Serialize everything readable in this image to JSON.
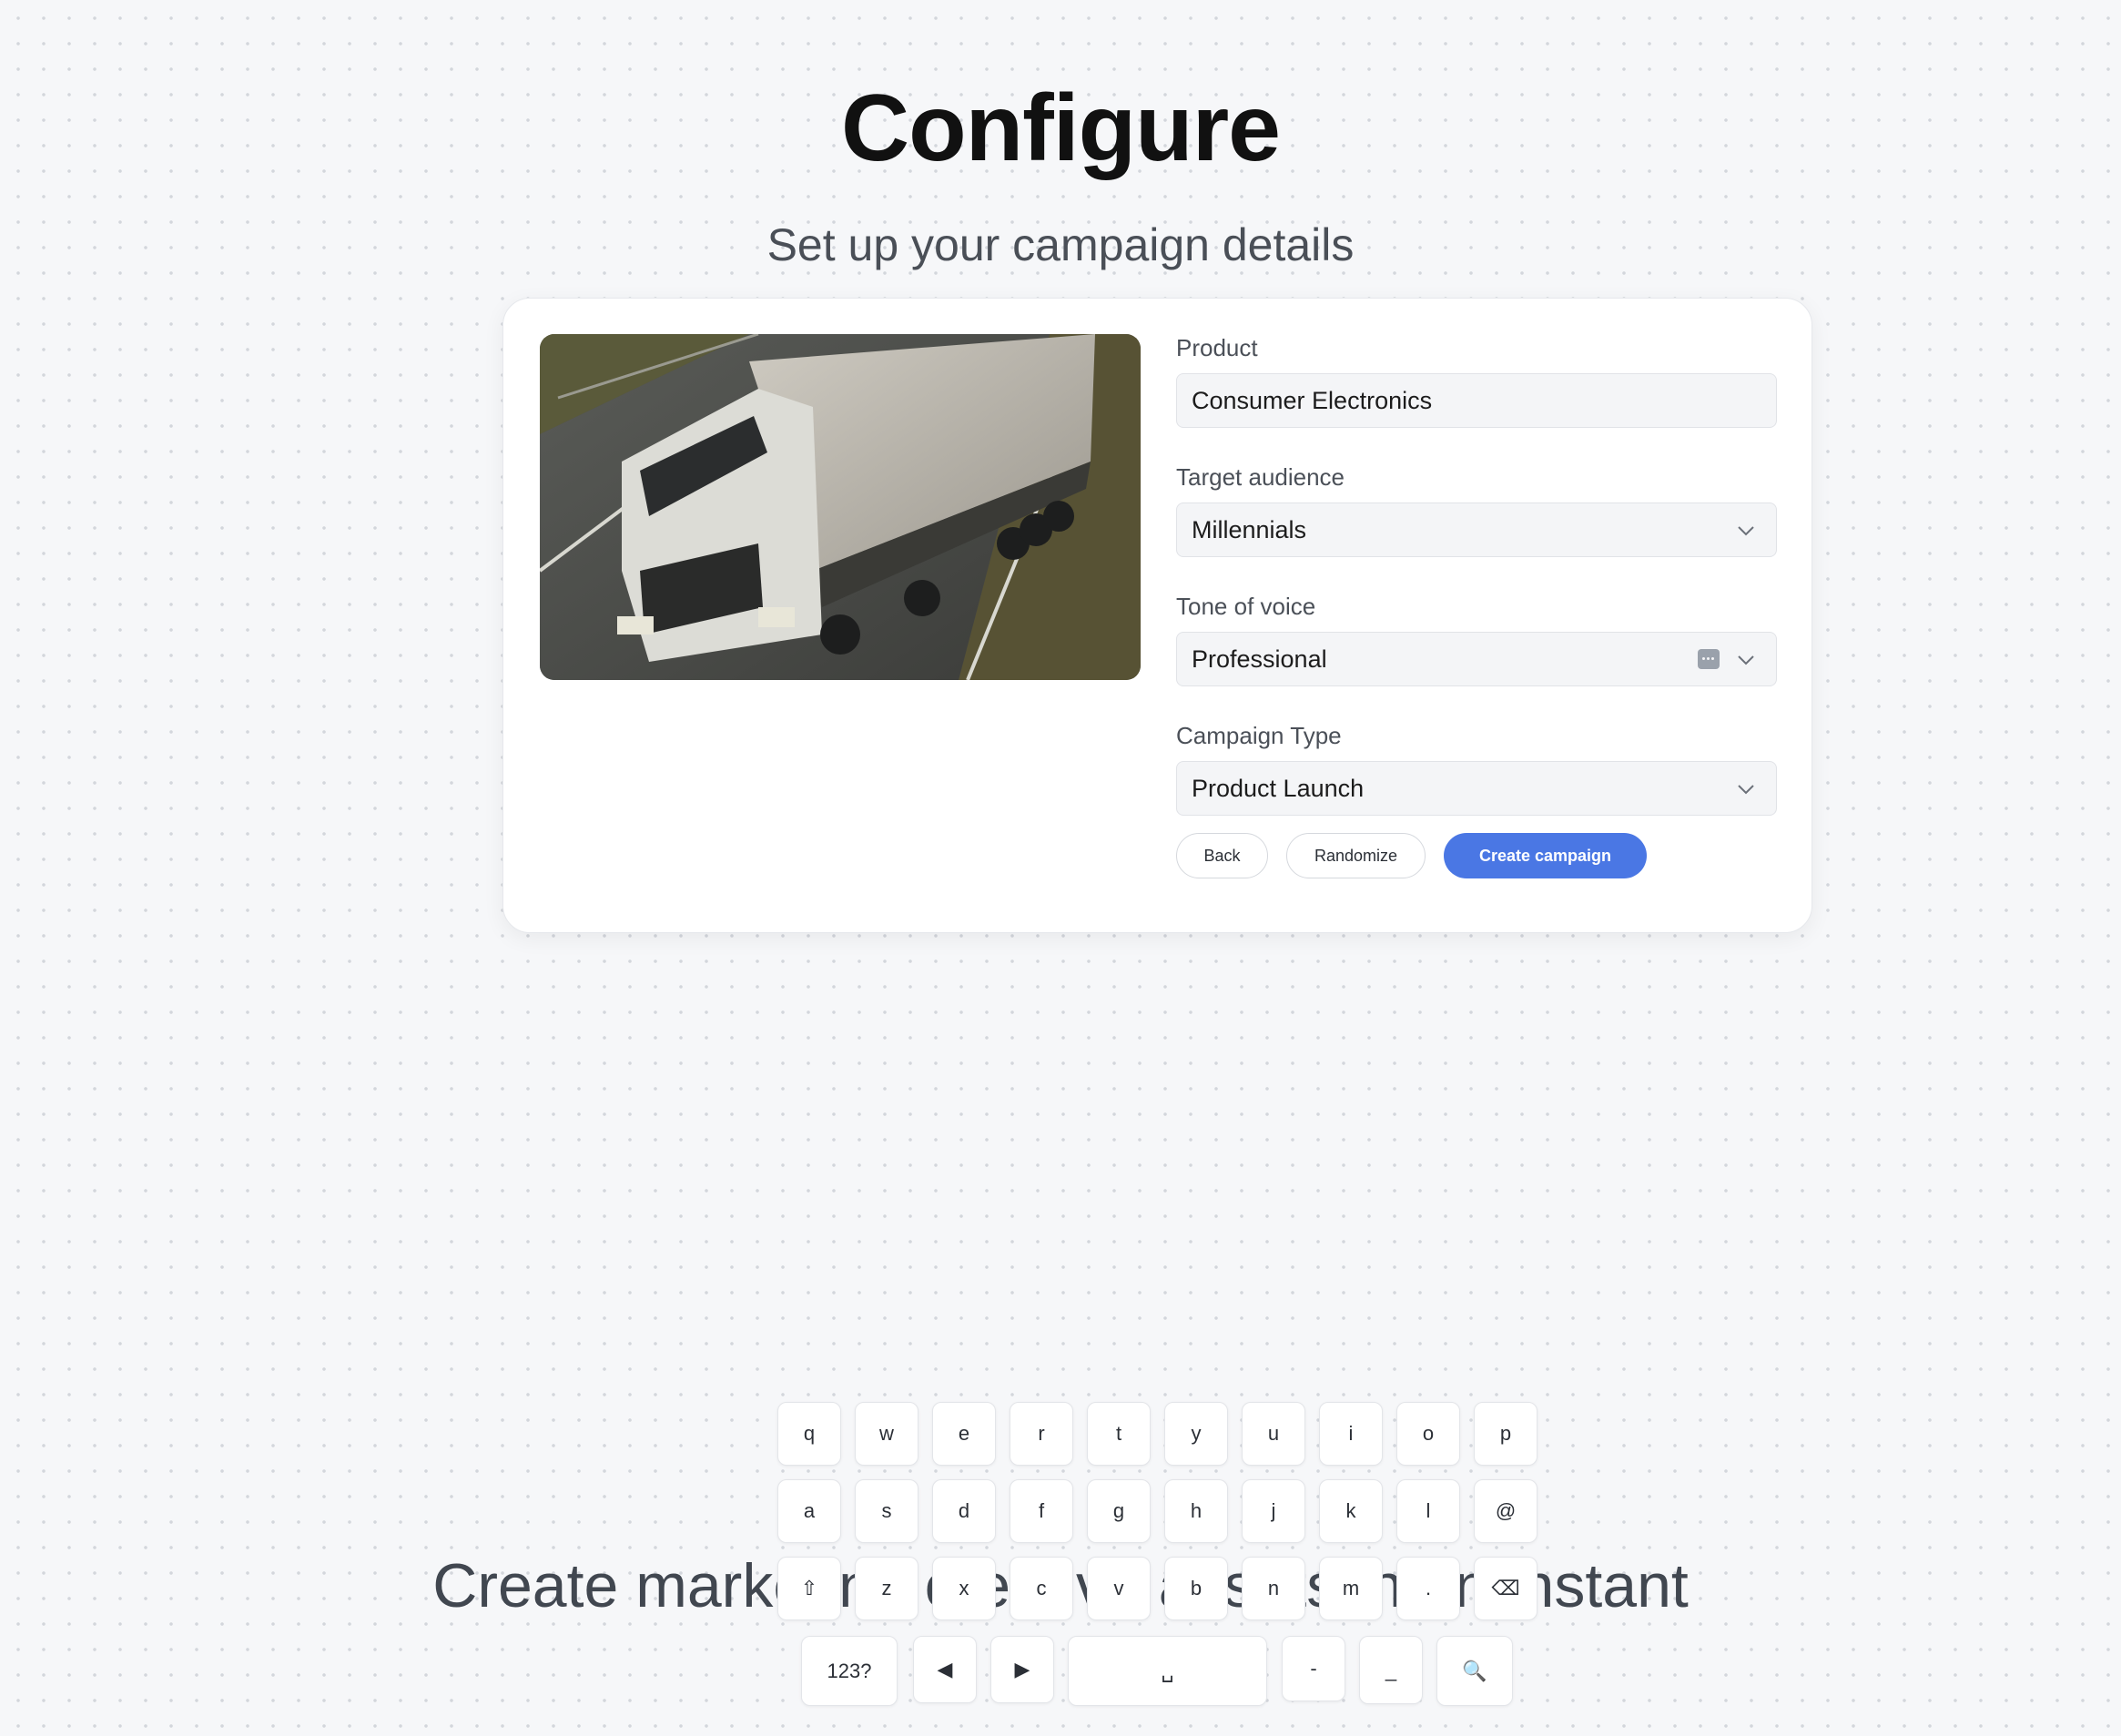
{
  "header": {
    "title": "Configure",
    "subtitle": "Set up your campaign details"
  },
  "image": {
    "alt": "truck-photo"
  },
  "form": {
    "product": {
      "label": "Product",
      "value": "Consumer Electronics"
    },
    "audience": {
      "label": "Target audience",
      "value": "Millennials"
    },
    "tone": {
      "label": "Tone of voice",
      "value": "Professional"
    },
    "campaign_type": {
      "label": "Campaign Type",
      "value": "Product Launch"
    }
  },
  "actions": {
    "back": "Back",
    "randomize": "Randomize",
    "create": "Create campaign"
  },
  "footer": {
    "tagline": "Create marketing creative assets in an instant"
  },
  "keyboard": {
    "row1": [
      "q",
      "w",
      "e",
      "r",
      "t",
      "y",
      "u",
      "i",
      "o",
      "p"
    ],
    "row2": [
      "a",
      "s",
      "d",
      "f",
      "g",
      "h",
      "j",
      "k",
      "l",
      "@"
    ],
    "row3": [
      "⇧",
      "z",
      "x",
      "c",
      "v",
      "b",
      "n",
      "m",
      ".",
      "⌫"
    ],
    "row4": [
      "123?",
      "◀",
      "▶",
      "␣",
      "-",
      "_",
      "🔍"
    ]
  },
  "colors": {
    "accent": "#4a77e4",
    "background": "#f6f7f9"
  }
}
